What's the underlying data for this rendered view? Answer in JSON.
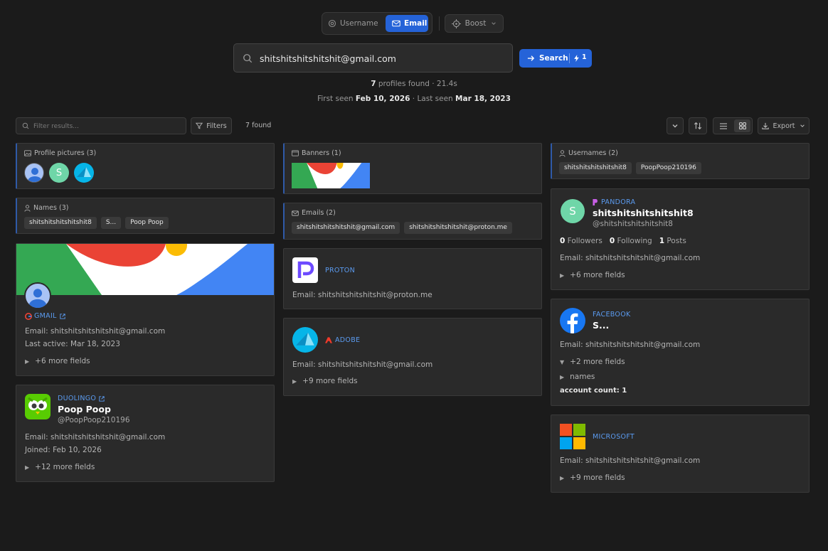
{
  "mode": {
    "username_label": "Username",
    "email_label": "Email",
    "boost_label": "Boost"
  },
  "search": {
    "value": "shitshitshitshitshit@gmail.com",
    "button_label": "Search",
    "credit": "1"
  },
  "summary": {
    "count": "7",
    "count_suffix": " profiles found · 21.4s",
    "first_label": "First seen ",
    "first_date": "Feb 10, 2026",
    "last_label": " · Last seen ",
    "last_date": "Mar 18, 2023"
  },
  "toolbar": {
    "filter_placeholder": "Filter results...",
    "filters_label": "Filters",
    "found_label": "7 found",
    "export_label": "Export"
  },
  "profile_pictures": {
    "title": "Profile pictures (3)"
  },
  "names": {
    "title": "Names (3)",
    "items": [
      "shitshitshitshitshit8",
      "S...",
      "Poop Poop"
    ]
  },
  "banners": {
    "title": "Banners (1)"
  },
  "emails": {
    "title": "Emails (2)",
    "items": [
      "shitshitshitshitshit@gmail.com",
      "shitshitshitshitshit@proton.me"
    ]
  },
  "usernames": {
    "title": "Usernames (2)",
    "items": [
      "shitshitshitshitshit8",
      "PoopPoop210196"
    ]
  },
  "gmail": {
    "platform": "GMAIL",
    "email": "Email: shitshitshitshitshit@gmail.com",
    "last_active": "Last active: Mar 18, 2023",
    "more": "+6 more fields"
  },
  "duolingo": {
    "platform": "DUOLINGO",
    "name": "Poop Poop",
    "handle": "@PoopPoop210196",
    "email": "Email: shitshitshitshitshit@gmail.com",
    "joined": "Joined: Feb 10, 2026",
    "more": "+12 more fields"
  },
  "proton": {
    "platform": "PROTON",
    "email": "Email: shitshitshitshitshit@proton.me"
  },
  "adobe": {
    "platform": "ADOBE",
    "email": "Email: shitshitshitshitshit@gmail.com",
    "more": "+9 more fields"
  },
  "pandora": {
    "platform": "PANDORA",
    "avatar_letter": "S",
    "name": "shitshitshitshitshit8",
    "handle": "@shitshitshitshitshit8",
    "followers": "0",
    "followers_label": " Followers",
    "following": "0",
    "following_label": " Following",
    "posts": "1",
    "posts_label": " Posts",
    "email": "Email: shitshitshitshitshit@gmail.com",
    "more": "+6 more fields"
  },
  "facebook": {
    "platform": "FACEBOOK",
    "name": "S...",
    "email": "Email: shitshitshitshitshit@gmail.com",
    "more": "+2 more fields",
    "names_label": "names",
    "account_count": "account count: 1"
  },
  "microsoft": {
    "platform": "MICROSOFT",
    "email": "Email: shitshitshitshitshit@gmail.com",
    "more": "+9 more fields"
  },
  "colors": {
    "accent": "#2563d8",
    "link": "#5b9bf0",
    "background": "#1b1b1b",
    "card": "#2a2a2a"
  }
}
